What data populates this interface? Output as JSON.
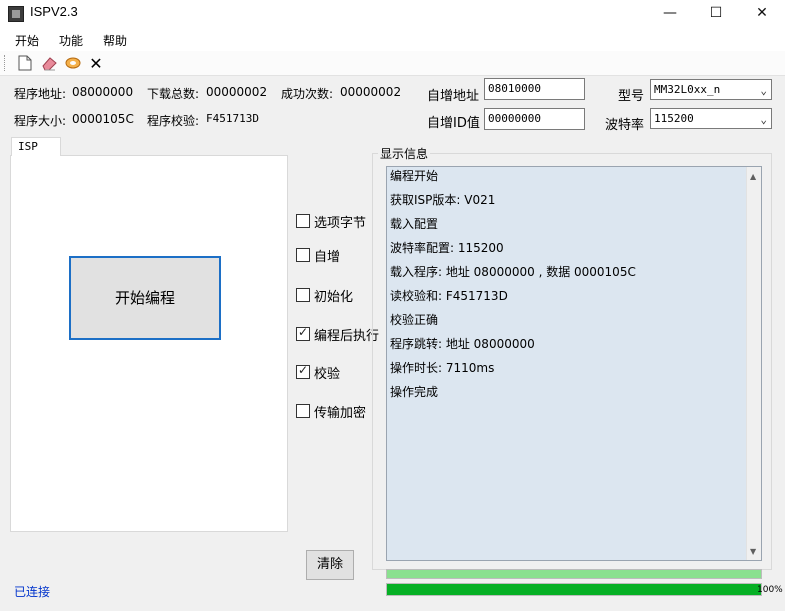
{
  "window": {
    "title": "ISPV2.3",
    "minimize": "—",
    "maximize": "☐",
    "close": "✕"
  },
  "menu": [
    "开始",
    "功能",
    "帮助"
  ],
  "toolbar": {
    "new_icon": "🗋",
    "erase_icon": "⌫",
    "reload_icon": "⟲",
    "close_icon": "✕"
  },
  "info": {
    "prog_addr_label": "程序地址:",
    "prog_addr_value": "08000000",
    "download_total_label": "下载总数:",
    "download_total_value": "00000002",
    "success_label": "成功次数:",
    "success_value": "00000002",
    "prog_size_label": "程序大小:",
    "prog_size_value": "0000105C",
    "checksum_label": "程序校验:",
    "checksum_value": "F451713D"
  },
  "settings": {
    "auto_addr_label": "自增地址",
    "auto_addr_value": "08010000",
    "auto_id_label": "自增ID值",
    "auto_id_value": "00000000",
    "model_label": "型号",
    "model_value": "MM32L0xx_n",
    "baud_label": "波特率",
    "baud_value": "115200"
  },
  "tab": {
    "label": "ISP"
  },
  "start_button": "开始编程",
  "options": [
    {
      "label": "选项字节",
      "checked": false
    },
    {
      "label": "自增",
      "checked": false
    },
    {
      "label": "初始化",
      "checked": false
    },
    {
      "label": "编程后执行",
      "checked": true
    },
    {
      "label": "校验",
      "checked": true
    },
    {
      "label": "传输加密",
      "checked": false
    }
  ],
  "log": {
    "title": "显示信息",
    "lines": [
      "编程开始",
      "获取ISP版本: V021",
      "载入配置",
      "波特率配置: 115200",
      "载入程序: 地址 08000000 , 数据 0000105C",
      "读校验和: F451713D",
      "校验正确",
      "程序跳转:  地址 08000000",
      "操作时长: 7110ms",
      "操作完成"
    ]
  },
  "clear_button": "清除",
  "progress": {
    "upper": 1.0,
    "lower": 1.0,
    "percent_text": "100%"
  },
  "status": "已连接"
}
